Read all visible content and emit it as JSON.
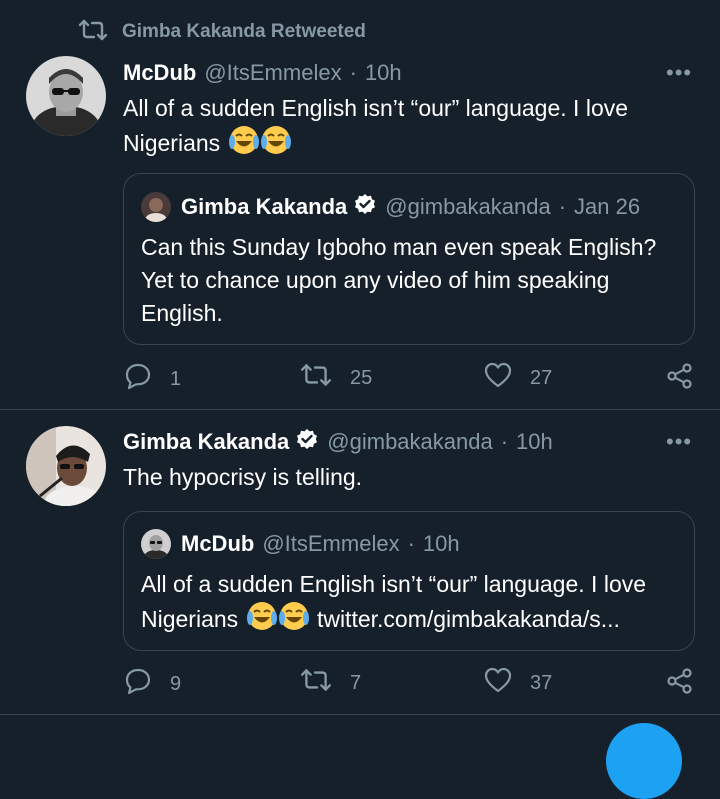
{
  "retweet_header": {
    "label": "Gimba Kakanda Retweeted"
  },
  "tweet1": {
    "name": "McDub",
    "handle": "@ItsEmmelex",
    "dot": "·",
    "time": "10h",
    "text_line1": "All of a sudden English isn’t “our” language. I love",
    "text_line2": "Nigerians",
    "quote": {
      "name": "Gimba Kakanda",
      "handle": "@gimbakakanda",
      "dot": "·",
      "time": "Jan 26",
      "line1": "Can this Sunday Igboho man even speak English?",
      "line2": "Yet to chance upon any video of him speaking",
      "line3": "English."
    },
    "actions": {
      "replies": "1",
      "retweets": "25",
      "likes": "27"
    }
  },
  "tweet2": {
    "name": "Gimba Kakanda",
    "handle": "@gimbakakanda",
    "dot": "·",
    "time": "10h",
    "text": "The hypocrisy is telling.",
    "quote": {
      "name": "McDub",
      "handle": "@ItsEmmelex",
      "dot": "·",
      "time": "10h",
      "line1": "All of a sudden English isn’t “our” language. I love",
      "line2_prefix": "Nigerians",
      "link": "twitter.com/gimbakakanda/s..."
    },
    "actions": {
      "replies": "9",
      "retweets": "7",
      "likes": "37"
    }
  },
  "more_glyph": "•••",
  "colors": {
    "background": "#15202b",
    "muted": "#8899a6",
    "border": "#38444d",
    "accent": "#1da1f2"
  }
}
